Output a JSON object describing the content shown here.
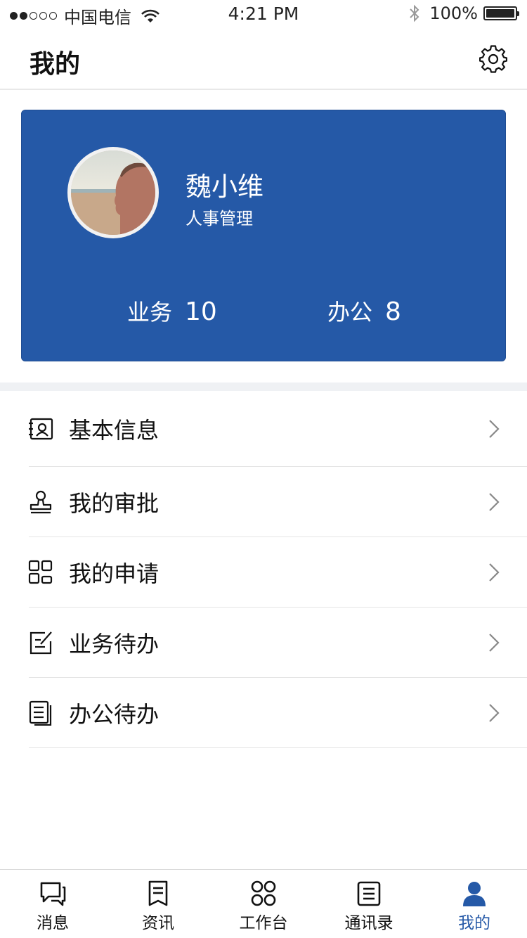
{
  "status_bar": {
    "carrier": "中国电信",
    "time": "4:21 PM",
    "battery": "100%"
  },
  "header": {
    "title": "我的",
    "settings_icon": "gear-icon"
  },
  "profile": {
    "name": "魏小维",
    "department": "人事管理",
    "stats": [
      {
        "label": "业务",
        "value": "10"
      },
      {
        "label": "办公",
        "value": "8"
      }
    ]
  },
  "menu": {
    "items": [
      {
        "label": "基本信息",
        "icon": "id-card-icon"
      },
      {
        "label": "我的审批",
        "icon": "stamp-icon"
      },
      {
        "label": "我的申请",
        "icon": "grid-icon"
      },
      {
        "label": "业务待办",
        "icon": "edit-doc-icon"
      },
      {
        "label": "办公待办",
        "icon": "document-icon"
      }
    ]
  },
  "tab_bar": {
    "tabs": [
      {
        "label": "消息",
        "icon": "chat-icon"
      },
      {
        "label": "资讯",
        "icon": "news-icon"
      },
      {
        "label": "工作台",
        "icon": "workbench-icon"
      },
      {
        "label": "通讯录",
        "icon": "contacts-icon"
      },
      {
        "label": "我的",
        "icon": "user-icon",
        "active": true
      }
    ]
  },
  "colors": {
    "primary": "#2559a7",
    "divider": "#eff1f4",
    "text": "#111111"
  }
}
